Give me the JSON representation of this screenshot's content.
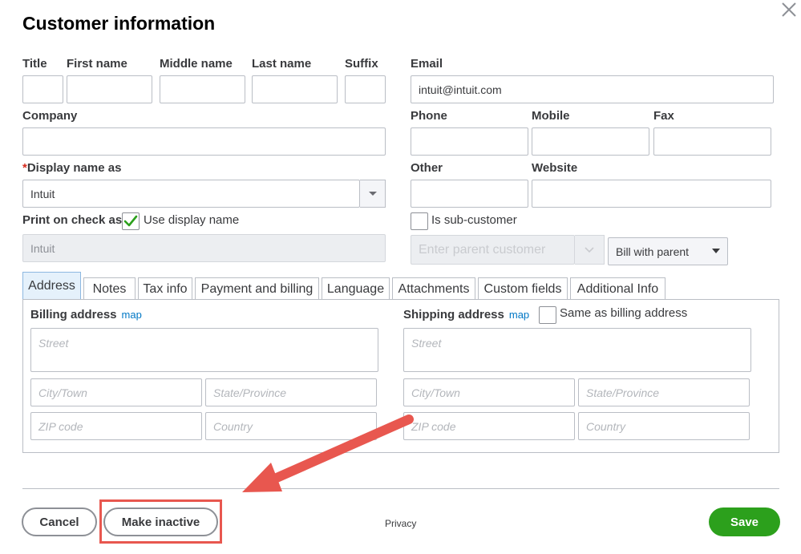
{
  "dialog": {
    "title": "Customer information"
  },
  "name_section": {
    "title_label": "Title",
    "first_name_label": "First name",
    "middle_name_label": "Middle name",
    "last_name_label": "Last name",
    "suffix_label": "Suffix",
    "company_label": "Company",
    "display_name_required": "*",
    "display_name_label": "Display name as",
    "display_name_value": "Intuit",
    "print_on_check_label": "Print on check as",
    "use_display_name_label": "Use display name",
    "use_display_name_checked": true,
    "print_on_check_value": "Intuit"
  },
  "contact_section": {
    "email_label": "Email",
    "email_value": "intuit@intuit.com",
    "phone_label": "Phone",
    "mobile_label": "Mobile",
    "fax_label": "Fax",
    "other_label": "Other",
    "website_label": "Website",
    "sub_customer_label": "Is sub-customer",
    "sub_customer_checked": false,
    "parent_customer_placeholder": "Enter parent customer",
    "bill_with_parent_value": "Bill with parent"
  },
  "tabs": [
    {
      "label": "Address",
      "active": true
    },
    {
      "label": "Notes",
      "active": false
    },
    {
      "label": "Tax info",
      "active": false
    },
    {
      "label": "Payment and billing",
      "active": false
    },
    {
      "label": "Language",
      "active": false
    },
    {
      "label": "Attachments",
      "active": false
    },
    {
      "label": "Custom fields",
      "active": false
    },
    {
      "label": "Additional Info",
      "active": false
    }
  ],
  "billing_address": {
    "label": "Billing address",
    "map_link": "map",
    "street_placeholder": "Street",
    "city_placeholder": "City/Town",
    "state_placeholder": "State/Province",
    "zip_placeholder": "ZIP code",
    "country_placeholder": "Country"
  },
  "shipping_address": {
    "label": "Shipping address",
    "map_link": "map",
    "same_as_billing_label": "Same as billing address",
    "same_as_billing_checked": false,
    "street_placeholder": "Street",
    "city_placeholder": "City/Town",
    "state_placeholder": "State/Province",
    "zip_placeholder": "ZIP code",
    "country_placeholder": "Country"
  },
  "footer": {
    "cancel_label": "Cancel",
    "make_inactive_label": "Make inactive",
    "privacy_label": "Privacy",
    "save_label": "Save"
  },
  "annotation": {
    "color": "#e8574f",
    "icon": "arrow-annotation-icon"
  },
  "colors": {
    "primary": "#2ca01c",
    "link": "#0077c5",
    "active_tab": "#e5f1fb"
  }
}
